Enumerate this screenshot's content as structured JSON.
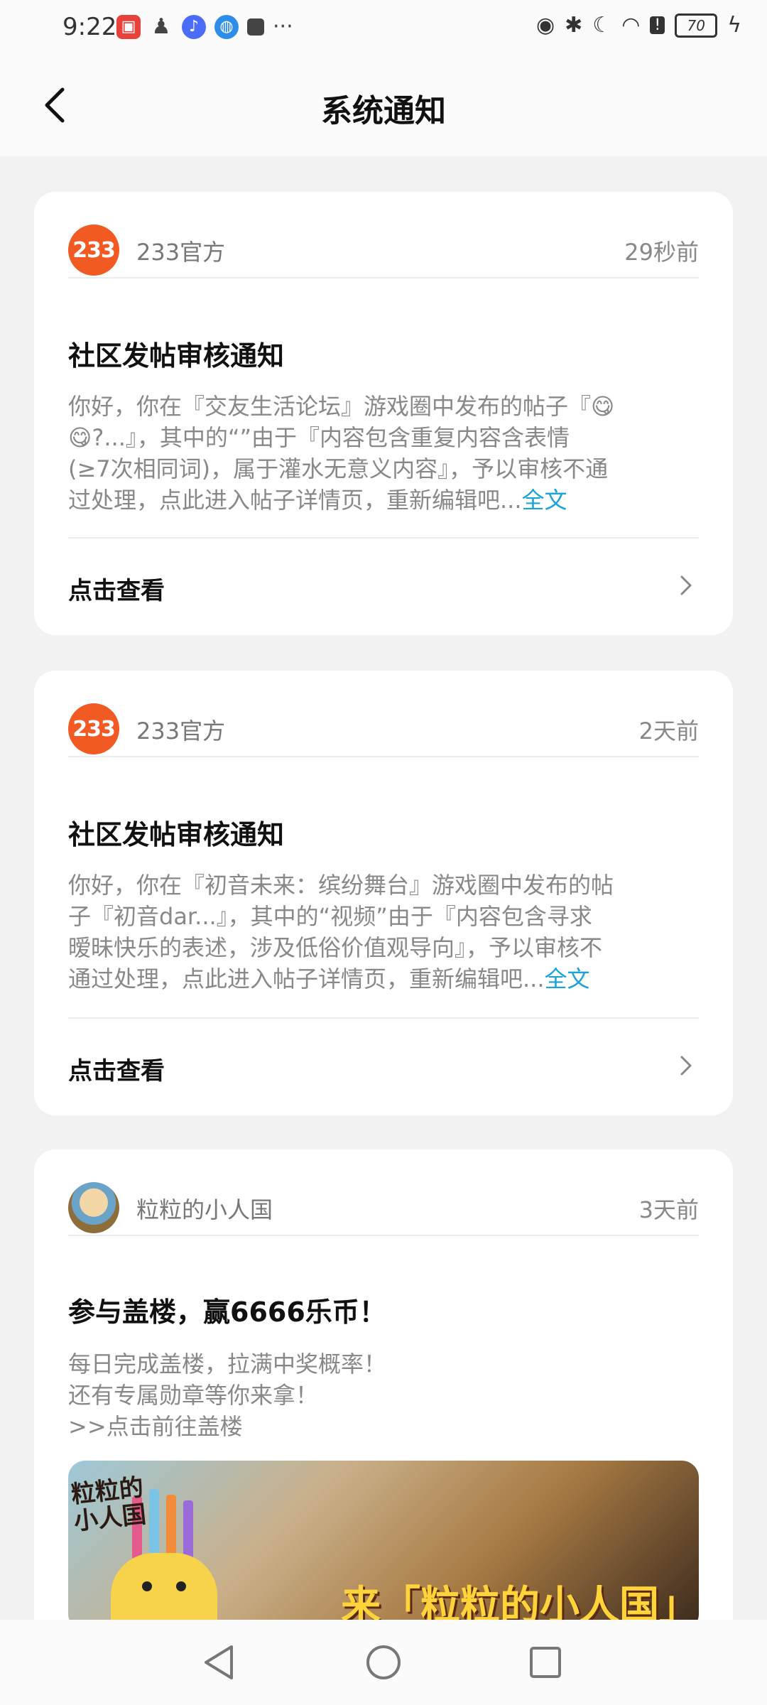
{
  "status_bar": {
    "time": "9:22",
    "battery": "70"
  },
  "header": {
    "title": "系统通知"
  },
  "notifications": [
    {
      "sender": "233官方",
      "avatar_text": "233",
      "time": "29秒前",
      "title": "社区发帖审核通知",
      "body_lines": [
        "你好，你在『交友生活论坛』游戏圈中发布的帖子『😋",
        "😋?...』，其中的“”由于『内容包含重复内容含表情",
        "(≥7次相同词)，属于灌水无意义内容』，予以审核不通",
        "过处理，点此进入帖子详情页，重新编辑吧..."
      ],
      "more": "全文",
      "action": "点击查看"
    },
    {
      "sender": "233官方",
      "avatar_text": "233",
      "time": "2天前",
      "title": "社区发帖审核通知",
      "body_lines": [
        "你好，你在『初音未来：缤纷舞台』游戏圈中发布的帖",
        "子『初音dar...』，其中的“视频”由于『内容包含寻求",
        "暧昧快乐的表述，涉及低俗价值观导向』，予以审核不",
        "通过处理，点此进入帖子详情页，重新编辑吧..."
      ],
      "more": "全文",
      "action": "点击查看"
    },
    {
      "sender": "粒粒的小人国",
      "time": "3天前",
      "title": "参与盖楼，赢6666乐币！",
      "body_lines": [
        "每日完成盖楼，拉满中奖概率！",
        "还有专属勋章等你来拿！",
        ">>点击前往盖楼"
      ],
      "banner_logo": "粒粒的\n小人国",
      "banner_title": "来「粒粒的小人国」"
    }
  ]
}
